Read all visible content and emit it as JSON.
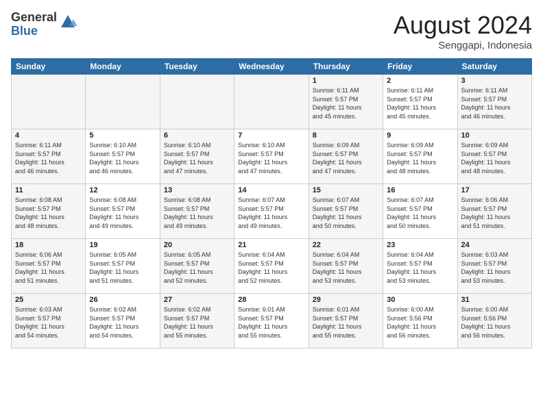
{
  "header": {
    "logo_general": "General",
    "logo_blue": "Blue",
    "month_year": "August 2024",
    "location": "Senggapi, Indonesia"
  },
  "weekdays": [
    "Sunday",
    "Monday",
    "Tuesday",
    "Wednesday",
    "Thursday",
    "Friday",
    "Saturday"
  ],
  "weeks": [
    [
      {
        "day": "",
        "info": ""
      },
      {
        "day": "",
        "info": ""
      },
      {
        "day": "",
        "info": ""
      },
      {
        "day": "",
        "info": ""
      },
      {
        "day": "1",
        "info": "Sunrise: 6:11 AM\nSunset: 5:57 PM\nDaylight: 11 hours\nand 45 minutes."
      },
      {
        "day": "2",
        "info": "Sunrise: 6:11 AM\nSunset: 5:57 PM\nDaylight: 11 hours\nand 45 minutes."
      },
      {
        "day": "3",
        "info": "Sunrise: 6:11 AM\nSunset: 5:57 PM\nDaylight: 11 hours\nand 46 minutes."
      }
    ],
    [
      {
        "day": "4",
        "info": "Sunrise: 6:11 AM\nSunset: 5:57 PM\nDaylight: 11 hours\nand 46 minutes."
      },
      {
        "day": "5",
        "info": "Sunrise: 6:10 AM\nSunset: 5:57 PM\nDaylight: 11 hours\nand 46 minutes."
      },
      {
        "day": "6",
        "info": "Sunrise: 6:10 AM\nSunset: 5:57 PM\nDaylight: 11 hours\nand 47 minutes."
      },
      {
        "day": "7",
        "info": "Sunrise: 6:10 AM\nSunset: 5:57 PM\nDaylight: 11 hours\nand 47 minutes."
      },
      {
        "day": "8",
        "info": "Sunrise: 6:09 AM\nSunset: 5:57 PM\nDaylight: 11 hours\nand 47 minutes."
      },
      {
        "day": "9",
        "info": "Sunrise: 6:09 AM\nSunset: 5:57 PM\nDaylight: 11 hours\nand 48 minutes."
      },
      {
        "day": "10",
        "info": "Sunrise: 6:09 AM\nSunset: 5:57 PM\nDaylight: 11 hours\nand 48 minutes."
      }
    ],
    [
      {
        "day": "11",
        "info": "Sunrise: 6:08 AM\nSunset: 5:57 PM\nDaylight: 11 hours\nand 48 minutes."
      },
      {
        "day": "12",
        "info": "Sunrise: 6:08 AM\nSunset: 5:57 PM\nDaylight: 11 hours\nand 49 minutes."
      },
      {
        "day": "13",
        "info": "Sunrise: 6:08 AM\nSunset: 5:57 PM\nDaylight: 11 hours\nand 49 minutes."
      },
      {
        "day": "14",
        "info": "Sunrise: 6:07 AM\nSunset: 5:57 PM\nDaylight: 11 hours\nand 49 minutes."
      },
      {
        "day": "15",
        "info": "Sunrise: 6:07 AM\nSunset: 5:57 PM\nDaylight: 11 hours\nand 50 minutes."
      },
      {
        "day": "16",
        "info": "Sunrise: 6:07 AM\nSunset: 5:57 PM\nDaylight: 11 hours\nand 50 minutes."
      },
      {
        "day": "17",
        "info": "Sunrise: 6:06 AM\nSunset: 5:57 PM\nDaylight: 11 hours\nand 51 minutes."
      }
    ],
    [
      {
        "day": "18",
        "info": "Sunrise: 6:06 AM\nSunset: 5:57 PM\nDaylight: 11 hours\nand 51 minutes."
      },
      {
        "day": "19",
        "info": "Sunrise: 6:05 AM\nSunset: 5:57 PM\nDaylight: 11 hours\nand 51 minutes."
      },
      {
        "day": "20",
        "info": "Sunrise: 6:05 AM\nSunset: 5:57 PM\nDaylight: 11 hours\nand 52 minutes."
      },
      {
        "day": "21",
        "info": "Sunrise: 6:04 AM\nSunset: 5:57 PM\nDaylight: 11 hours\nand 52 minutes."
      },
      {
        "day": "22",
        "info": "Sunrise: 6:04 AM\nSunset: 5:57 PM\nDaylight: 11 hours\nand 53 minutes."
      },
      {
        "day": "23",
        "info": "Sunrise: 6:04 AM\nSunset: 5:57 PM\nDaylight: 11 hours\nand 53 minutes."
      },
      {
        "day": "24",
        "info": "Sunrise: 6:03 AM\nSunset: 5:57 PM\nDaylight: 11 hours\nand 53 minutes."
      }
    ],
    [
      {
        "day": "25",
        "info": "Sunrise: 6:03 AM\nSunset: 5:57 PM\nDaylight: 11 hours\nand 54 minutes."
      },
      {
        "day": "26",
        "info": "Sunrise: 6:02 AM\nSunset: 5:57 PM\nDaylight: 11 hours\nand 54 minutes."
      },
      {
        "day": "27",
        "info": "Sunrise: 6:02 AM\nSunset: 5:57 PM\nDaylight: 11 hours\nand 55 minutes."
      },
      {
        "day": "28",
        "info": "Sunrise: 6:01 AM\nSunset: 5:57 PM\nDaylight: 11 hours\nand 55 minutes."
      },
      {
        "day": "29",
        "info": "Sunrise: 6:01 AM\nSunset: 5:57 PM\nDaylight: 11 hours\nand 55 minutes."
      },
      {
        "day": "30",
        "info": "Sunrise: 6:00 AM\nSunset: 5:56 PM\nDaylight: 11 hours\nand 56 minutes."
      },
      {
        "day": "31",
        "info": "Sunrise: 6:00 AM\nSunset: 5:56 PM\nDaylight: 11 hours\nand 56 minutes."
      }
    ]
  ]
}
